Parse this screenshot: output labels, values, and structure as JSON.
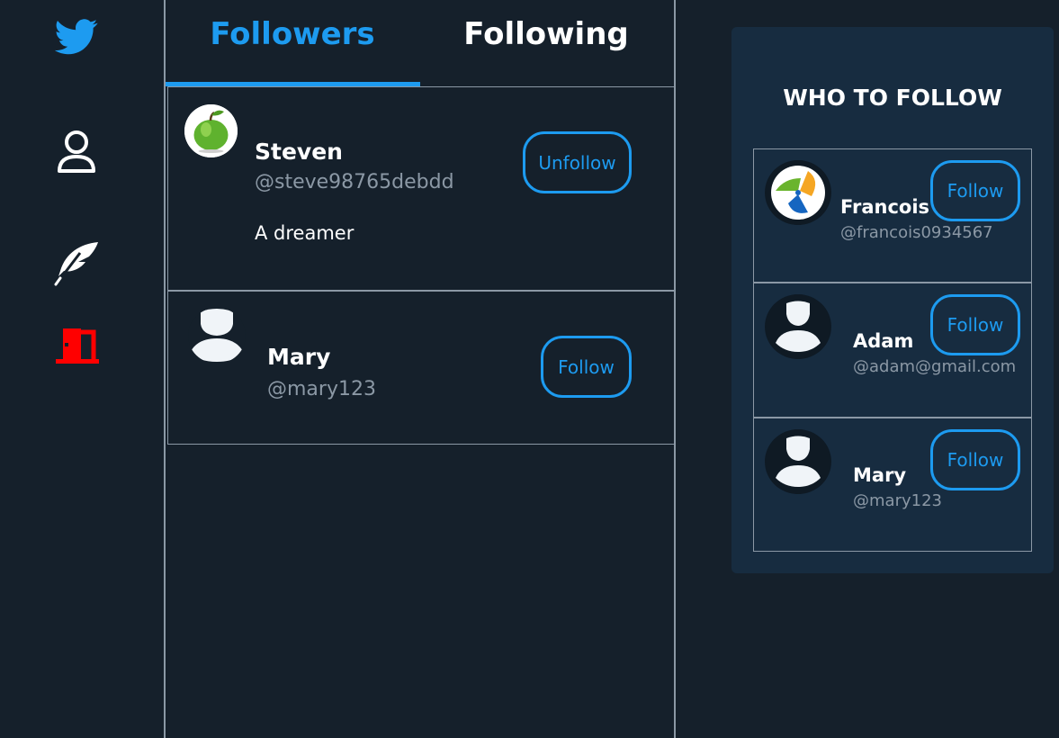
{
  "nav": {
    "items": [
      {
        "icon": "twitter-bird-icon",
        "color": "#1d9bf0"
      },
      {
        "icon": "profile-icon",
        "color": "#ffffff"
      },
      {
        "icon": "feather-icon",
        "color": "#ffffff"
      },
      {
        "icon": "logout-door-icon",
        "color": "#ff0000"
      }
    ]
  },
  "tabs": {
    "followers": "Followers",
    "following": "Following",
    "active": "followers"
  },
  "followers": [
    {
      "name": "Steven",
      "handle": "@steve98765debdd",
      "bio": "A dreamer",
      "button": "Unfollow",
      "avatar": "green-apple-avatar"
    },
    {
      "name": "Mary",
      "handle": "@mary123",
      "bio": "",
      "button": "Follow",
      "avatar": "default-user-avatar"
    }
  ],
  "who_to_follow": {
    "title": "WHO TO FOLLOW",
    "users": [
      {
        "name": "Francois",
        "handle": "@francois0934567",
        "button": "Follow",
        "avatar": "pinwheel-logo-avatar"
      },
      {
        "name": "Adam",
        "handle": "@adam@gmail.com",
        "button": "Follow",
        "avatar": "default-user-avatar"
      },
      {
        "name": "Mary",
        "handle": "@mary123",
        "button": "Follow",
        "avatar": "default-user-avatar"
      }
    ]
  },
  "colors": {
    "background": "#15202b",
    "accent": "#1d9bf0",
    "panel": "#172c40",
    "muted": "#8b98a5",
    "logout": "#ff0000"
  }
}
